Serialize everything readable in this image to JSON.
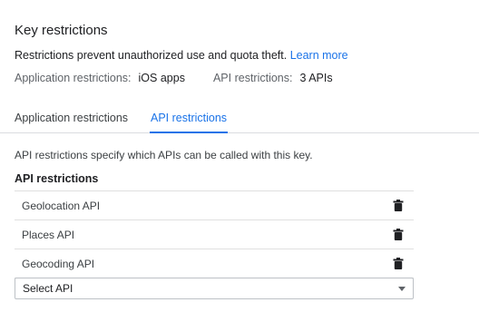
{
  "header": {
    "title": "Key restrictions",
    "intro_text": "Restrictions prevent unauthorized use and quota theft.",
    "learn_more_label": "Learn more"
  },
  "summary": {
    "app_key": "Application restrictions:",
    "app_value": "iOS apps",
    "api_key": "API restrictions:",
    "api_value": "3 APIs"
  },
  "tabs": [
    {
      "label": "Application restrictions",
      "active": false
    },
    {
      "label": "API restrictions",
      "active": true
    }
  ],
  "api_section": {
    "description": "API restrictions specify which APIs can be called with this key.",
    "list_title": "API restrictions",
    "items": [
      {
        "name": "Geolocation API"
      },
      {
        "name": "Places API"
      },
      {
        "name": "Geocoding API"
      }
    ],
    "select_value": "Select API"
  },
  "colors": {
    "accent": "#1a73e8",
    "text": "#202124",
    "muted": "#5f6368",
    "divider": "#e0e0e0"
  },
  "icons": {
    "delete": "trash-icon",
    "dropdown": "chevron-down-icon"
  }
}
